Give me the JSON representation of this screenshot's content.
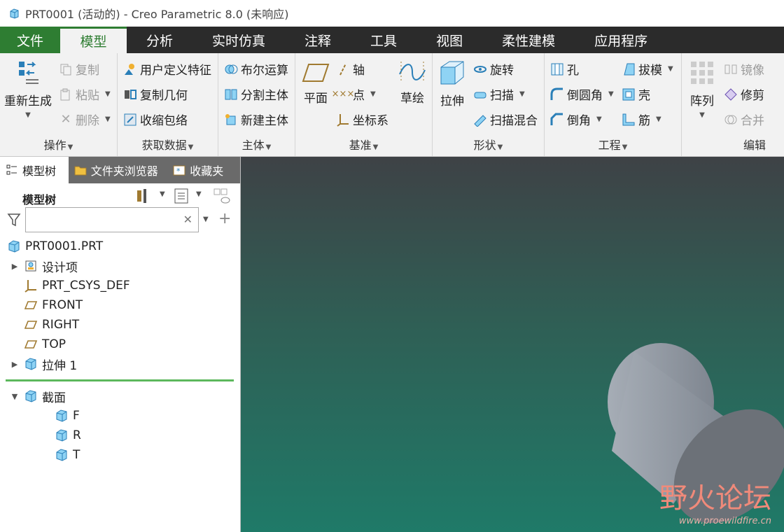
{
  "window": {
    "title": "PRT0001 (活动的) - Creo Parametric 8.0 (未响应)"
  },
  "menu": {
    "file": "文件",
    "tabs": [
      "模型",
      "分析",
      "实时仿真",
      "注释",
      "工具",
      "视图",
      "柔性建模",
      "应用程序"
    ]
  },
  "ribbon": {
    "operations": {
      "regenerate": "重新生成",
      "copy": "复制",
      "paste": "粘贴",
      "delete": "删除",
      "label": "操作"
    },
    "get_data": {
      "udf": "用户定义特征",
      "copy_geom": "复制几何",
      "shrinkwrap": "收缩包络",
      "label": "获取数据"
    },
    "body": {
      "boolean": "布尔运算",
      "split": "分割主体",
      "new_body": "新建主体",
      "label": "主体"
    },
    "datum": {
      "plane": "平面",
      "axis": "轴",
      "point": "点",
      "csys": "坐标系",
      "sketch": "草绘",
      "label": "基准"
    },
    "shapes": {
      "extrude": "拉伸",
      "revolve": "旋转",
      "sweep": "扫描",
      "swept_blend": "扫描混合",
      "label": "形状"
    },
    "engineering": {
      "hole": "孔",
      "round": "倒圆角",
      "chamfer": "倒角",
      "draft": "拔模",
      "shell": "壳",
      "rib": "筋",
      "label": "工程"
    },
    "editing": {
      "pattern": "阵列",
      "mirror": "镜像",
      "trim": "修剪",
      "merge": "合并",
      "label": "编辑"
    }
  },
  "panel": {
    "tabs": [
      "模型树",
      "文件夹浏览器",
      "收藏夹"
    ],
    "tree_title": "模型树",
    "search": {
      "value": "",
      "placeholder": ""
    },
    "tree": [
      {
        "label": "PRT0001.PRT",
        "icon": "part-icon",
        "indent": 0,
        "expander": ""
      },
      {
        "label": "设计项",
        "icon": "design-items-icon",
        "indent": 1,
        "expander": "▶"
      },
      {
        "label": "PRT_CSYS_DEF",
        "icon": "csys-icon",
        "indent": 1,
        "expander": ""
      },
      {
        "label": "FRONT",
        "icon": "datum-plane-icon",
        "indent": 1,
        "expander": ""
      },
      {
        "label": "RIGHT",
        "icon": "datum-plane-icon",
        "indent": 1,
        "expander": ""
      },
      {
        "label": "TOP",
        "icon": "datum-plane-icon",
        "indent": 1,
        "expander": ""
      },
      {
        "label": "拉伸 1",
        "icon": "extrude-icon",
        "indent": 1,
        "expander": "▶"
      }
    ],
    "sections": [
      {
        "label": "截面",
        "icon": "section-icon",
        "indent": 1,
        "expander": "▼"
      },
      {
        "label": "F",
        "icon": "section-icon",
        "indent": 2,
        "expander": ""
      },
      {
        "label": "R",
        "icon": "section-icon",
        "indent": 2,
        "expander": ""
      },
      {
        "label": "T",
        "icon": "section-icon",
        "indent": 2,
        "expander": ""
      }
    ]
  },
  "watermark": {
    "main": "野火论坛",
    "sub": "www.proewildfire.cn"
  },
  "colors": {
    "accent": "#2e7d32",
    "divider": "#5cb85c",
    "menubar": "#2b2b2b"
  }
}
